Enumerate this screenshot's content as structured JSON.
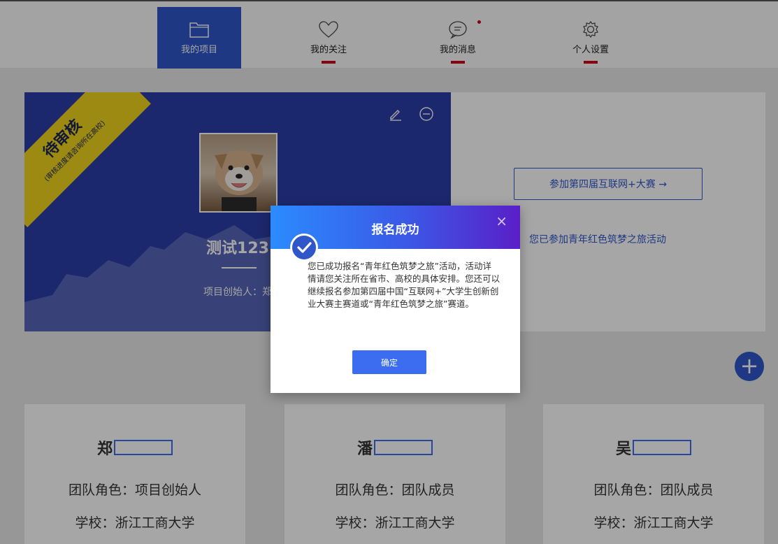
{
  "nav": {
    "items": [
      {
        "label": "我的项目",
        "icon": "folder-icon",
        "active": true
      },
      {
        "label": "我的关注",
        "icon": "heart-icon"
      },
      {
        "label": "我的消息",
        "icon": "message-icon"
      },
      {
        "label": "个人设置",
        "icon": "gear-icon"
      }
    ]
  },
  "project": {
    "ribbon_title": "待审核",
    "ribbon_note": "(审核进度请咨询所在高校)",
    "name": "测试123",
    "creator": "项目创始人：郑",
    "join_button": "参加第四届互联网+大赛 →",
    "joined_text": "您已参加青年红色筑梦之旅活动"
  },
  "add_button": "+",
  "members": [
    {
      "surname": "郑",
      "role": "团队角色：项目创始人",
      "school": "学校：浙江工商大学"
    },
    {
      "surname": "潘",
      "role": "团队角色：团队成员",
      "school": "学校：浙江工商大学"
    },
    {
      "surname": "吴",
      "role": "团队角色：团队成员",
      "school": "学校：浙江工商大学"
    }
  ],
  "modal": {
    "title": "报名成功",
    "close": "×",
    "body": "您已成功报名“青年红色筑梦之旅”活动，活动详情请您关注所在省市、高校的具体安排。您还可以继续报名参加第四届中国“互联网+”大学生创新创业大赛主赛道或“青年红色筑梦之旅”赛道。",
    "ok_label": "确定"
  },
  "colors": {
    "accent": "#2f57c9",
    "ribbon": "#f0d51d",
    "nav_underline": "#d0021b"
  }
}
